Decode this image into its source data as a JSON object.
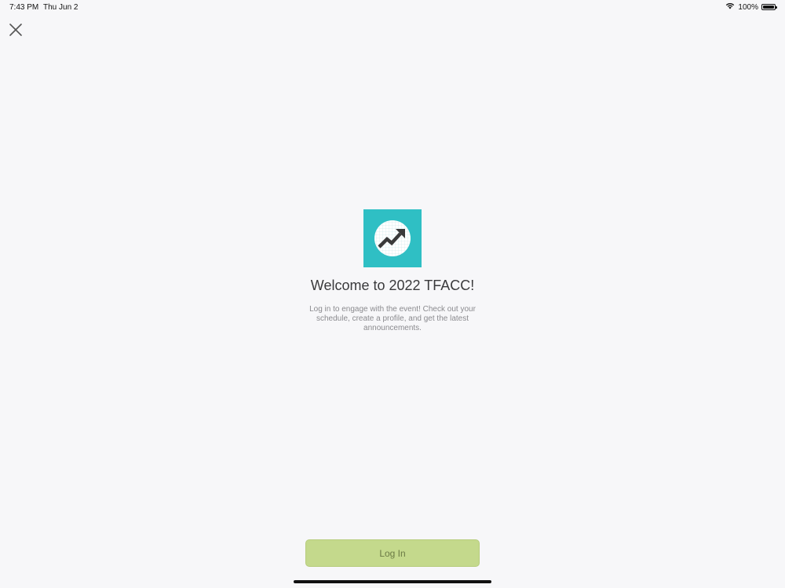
{
  "status_bar": {
    "time": "7:43 PM",
    "date": "Thu Jun 2",
    "battery_percent_label": "100%",
    "battery_level": 1.0,
    "wifi_icon": "wifi-icon",
    "battery_icon": "battery-icon"
  },
  "close_icon": "close-icon",
  "logo_icon": "trending-up-chart-icon",
  "welcome": {
    "title": "Welcome to 2022 TFACC!",
    "description": "Log in to engage with the event! Check out your schedule, create a profile, and get the latest announcements."
  },
  "login": {
    "label": "Log In"
  },
  "colors": {
    "background": "#f7f7f9",
    "logo_background": "#2fbfc4",
    "button_background": "#c4d98c",
    "button_text": "#6b7a45"
  }
}
